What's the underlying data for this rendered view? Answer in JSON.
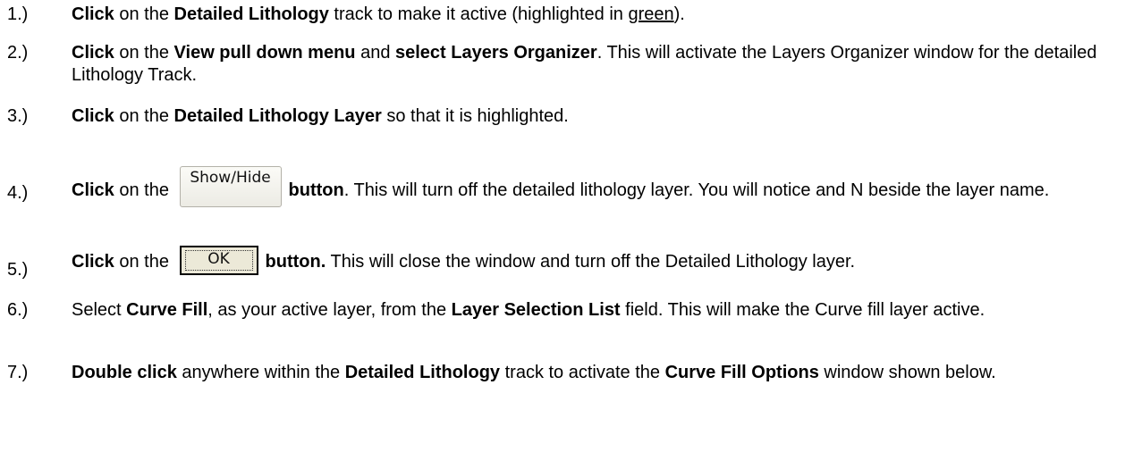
{
  "steps": [
    {
      "num": "1.)",
      "parts": [
        {
          "b": "Click"
        },
        {
          "t": " on the "
        },
        {
          "b": "Detailed Lithology"
        },
        {
          "t": " track to make it active (highlighted in "
        },
        {
          "u": "green"
        },
        {
          "t": ")."
        }
      ]
    },
    {
      "num": "2.)",
      "parts": [
        {
          "b": "Click"
        },
        {
          "t": " on the "
        },
        {
          "b": "View pull down menu"
        },
        {
          "t": " and "
        },
        {
          "b": "select Layers Organizer"
        },
        {
          "t": ". This will activate the Layers Organizer window for the detailed Lithology Track."
        }
      ]
    },
    {
      "num": "3.)",
      "parts": [
        {
          "b": "Click"
        },
        {
          "t": " on the "
        },
        {
          "b": "Detailed Lithology Layer"
        },
        {
          "t": " so that it is highlighted."
        }
      ]
    },
    {
      "num": "4.)",
      "parts": [
        {
          "b": "Click"
        },
        {
          "t": " on the "
        },
        {
          "btn": "showhide"
        },
        {
          "b": "button"
        },
        {
          "t": ". This will turn off the detailed lithology layer. You will notice and N beside the layer name."
        }
      ]
    },
    {
      "num": "5.)",
      "parts": [
        {
          "b": "Click"
        },
        {
          "t": " on the "
        },
        {
          "btn": "ok"
        },
        {
          "b": "button."
        },
        {
          "t": " This will close the window and turn off the Detailed Lithology layer."
        }
      ]
    },
    {
      "num": "6.)",
      "parts": [
        {
          "t": "Select "
        },
        {
          "b": "Curve Fill"
        },
        {
          "t": ", as your active layer, from the "
        },
        {
          "b": "Layer Selection List"
        },
        {
          "t": " field. This will make the Curve fill layer active."
        }
      ]
    },
    {
      "num": "7.)",
      "parts": [
        {
          "b": "Double click"
        },
        {
          "t": " anywhere within the "
        },
        {
          "b": "Detailed Lithology"
        },
        {
          "t": " track to activate the "
        },
        {
          "b": "Curve Fill Options"
        },
        {
          "t": " window shown below."
        }
      ]
    }
  ],
  "buttons": {
    "showhide_label": "Show/Hide",
    "ok_label": "OK"
  }
}
